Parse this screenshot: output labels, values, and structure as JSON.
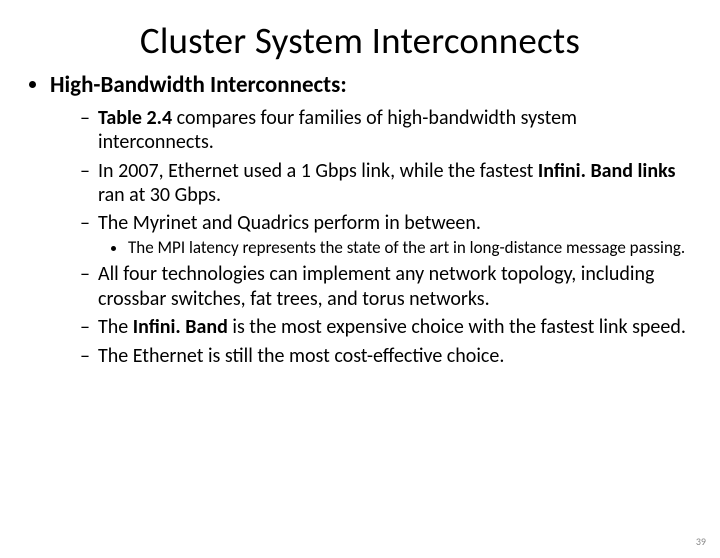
{
  "title": "Cluster System Interconnects",
  "bullets": {
    "lvl1_label": "High-Bandwidth Interconnects:",
    "lvl2": [
      {
        "pre": "",
        "bold": "Table 2.4",
        "post": " compares four families of high-bandwidth system interconnects."
      },
      {
        "pre": "In 2007, Ethernet used a 1 Gbps link, while the fastest ",
        "bold": "Infini. Band links",
        "post": " ran at 30 Gbps."
      },
      {
        "pre": "The Myrinet and Quadrics perform in between.",
        "bold": "",
        "post": ""
      }
    ],
    "lvl3": [
      "The MPI latency represents the state of the art in long-distance message passing."
    ],
    "lvl2b": [
      {
        "pre": "All four technologies can implement any network topology, including crossbar switches, fat trees, and torus networks.",
        "bold": "",
        "post": ""
      },
      {
        "pre": "The ",
        "bold": "Infini. Band",
        "post": " is the most expensive choice with the fastest link speed."
      },
      {
        "pre": "The Ethernet is still the most cost-effective choice.",
        "bold": "",
        "post": ""
      }
    ]
  },
  "page_number": "39"
}
